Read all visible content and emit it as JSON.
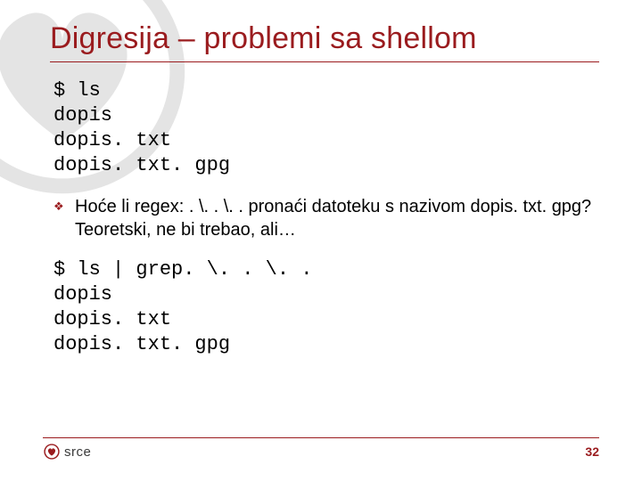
{
  "title": "Digresija – problemi sa shellom",
  "code_block_1": "$ ls\ndopis\ndopis. txt\ndopis. txt. gpg",
  "bullet_text": "Hoće li regex:  . \\. . \\. .  pronaći datoteku s nazivom dopis. txt. gpg? Teoretski, ne bi trebao, ali…",
  "code_block_2": "$ ls | grep. \\. . \\. .\ndopis\ndopis. txt\ndopis. txt. gpg",
  "footer": {
    "logo_text": "srce",
    "page_number": "32"
  },
  "colors": {
    "accent": "#9a1b1e"
  }
}
